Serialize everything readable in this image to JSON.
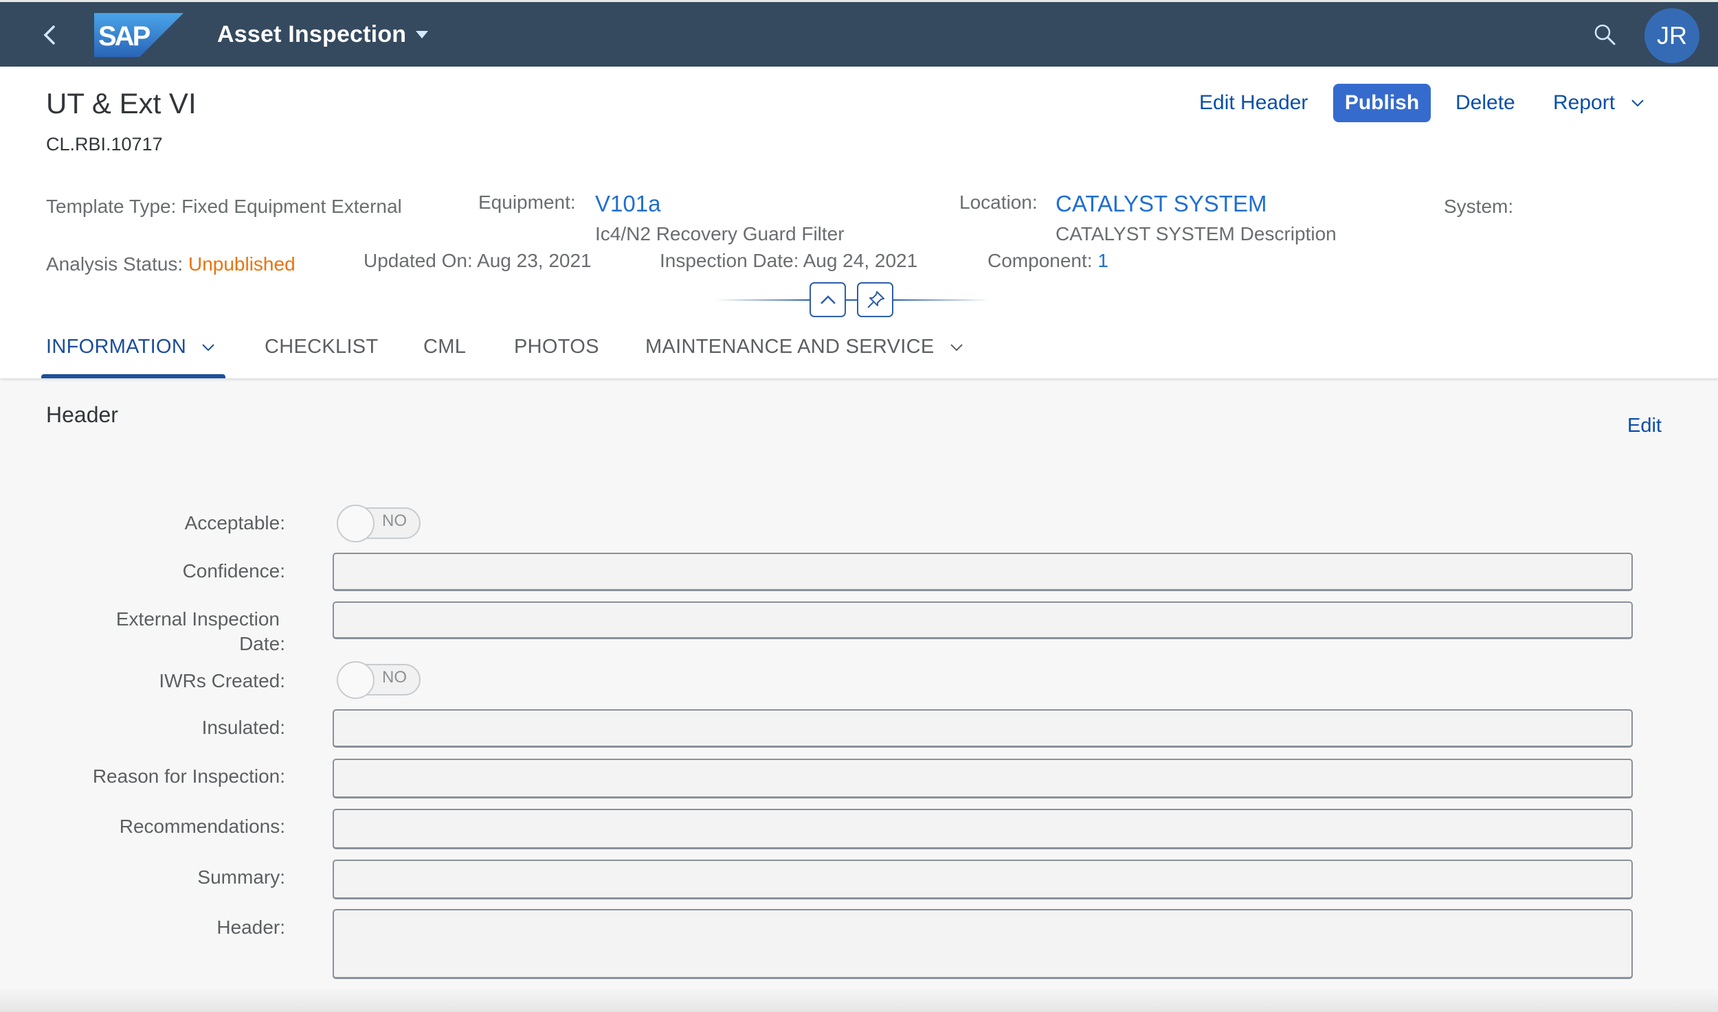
{
  "shell": {
    "app_title": "Asset Inspection",
    "logo_text": "SAP",
    "avatar_initials": "JR",
    "icons": {
      "back": "chevron-left-icon",
      "search": "search-icon",
      "menu": "caret-down-icon"
    }
  },
  "object_header": {
    "title": "UT & Ext VI",
    "subtitle": "CL.RBI.10717",
    "actions": {
      "edit_header": "Edit Header",
      "publish": "Publish",
      "delete": "Delete",
      "report": "Report"
    },
    "attributes": {
      "template_type_label": "Template Type:",
      "template_type_value": "Fixed Equipment External",
      "equipment_label": "Equipment:",
      "equipment_value": "V101a",
      "equipment_description": "Ic4/N2 Recovery Guard Filter",
      "location_label": "Location:",
      "location_value": "CATALYST SYSTEM",
      "location_description": "CATALYST SYSTEM Description",
      "system_label": "System:",
      "analysis_status_label": "Analysis Status:",
      "analysis_status_value": "Unpublished",
      "updated_on_label": "Updated On:",
      "updated_on_value": "Aug 23, 2021",
      "inspection_date_label": "Inspection Date:",
      "inspection_date_value": "Aug 24, 2021",
      "component_label": "Component:",
      "component_value": "1"
    },
    "colors": {
      "link": "#1f6fd1",
      "status_unpublished": "#e9730c",
      "publish_button": "#356bcd",
      "shell": "#354a5f"
    }
  },
  "tabs": [
    {
      "label": "INFORMATION",
      "active": true,
      "has_menu": true
    },
    {
      "label": "CHECKLIST",
      "active": false,
      "has_menu": false
    },
    {
      "label": "CML",
      "active": false,
      "has_menu": false
    },
    {
      "label": "PHOTOS",
      "active": false,
      "has_menu": false
    },
    {
      "label": "MAINTENANCE AND SERVICE",
      "active": false,
      "has_menu": true
    }
  ],
  "section": {
    "title": "Header",
    "edit_label": "Edit",
    "fields": [
      {
        "label": "Acceptable:",
        "type": "toggle",
        "value": "NO"
      },
      {
        "label": "Confidence:",
        "type": "input",
        "value": ""
      },
      {
        "label": "External Inspection",
        "label2": "Date:",
        "type": "input",
        "value": ""
      },
      {
        "label": "IWRs Created:",
        "type": "toggle",
        "value": "NO"
      },
      {
        "label": "Insulated:",
        "type": "input",
        "value": ""
      },
      {
        "label": "Reason for Inspection:",
        "type": "input",
        "value": ""
      },
      {
        "label": "Recommendations:",
        "type": "input",
        "value": ""
      },
      {
        "label": "Summary:",
        "type": "input",
        "value": ""
      },
      {
        "label": "Header:",
        "type": "textarea",
        "value": ""
      }
    ]
  }
}
